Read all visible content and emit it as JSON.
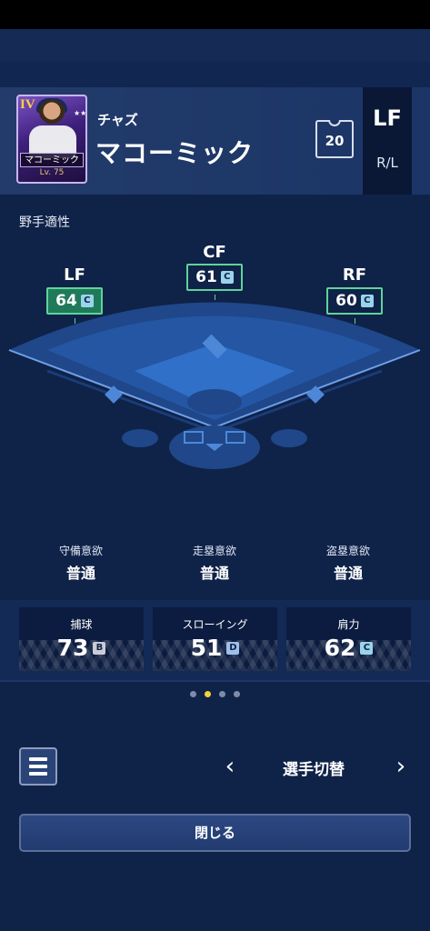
{
  "player": {
    "first_name": "チャズ",
    "last_name": "マコーミック",
    "card_name": "マコーミック",
    "card_rank": "IV",
    "card_level": "Lv. 75",
    "card_stars": "★★★★★",
    "jersey_number": "20",
    "position": "LF",
    "bats_throws": "R/L"
  },
  "fielding": {
    "title": "野手適性",
    "positions": [
      {
        "label": "LF",
        "value": "64",
        "grade": "C"
      },
      {
        "label": "CF",
        "value": "61",
        "grade": "C"
      },
      {
        "label": "RF",
        "value": "60",
        "grade": "C"
      }
    ]
  },
  "tendencies": [
    {
      "label": "守備意欲",
      "value": "普通"
    },
    {
      "label": "走塁意欲",
      "value": "普通"
    },
    {
      "label": "盗塁意欲",
      "value": "普通"
    }
  ],
  "stats": [
    {
      "label": "捕球",
      "value": "73",
      "grade": "B"
    },
    {
      "label": "スローイング",
      "value": "51",
      "grade": "D"
    },
    {
      "label": "肩力",
      "value": "62",
      "grade": "C"
    }
  ],
  "pagination": {
    "total": 4,
    "active_index": 1
  },
  "nav": {
    "prev": "‹",
    "next": "›",
    "switch_label": "選手切替",
    "close_label": "閉じる"
  },
  "colors": {
    "background": "#0f2248",
    "header": "#1b3566",
    "accent_green": "#5fd39a",
    "active_dot": "#f0d23a"
  }
}
